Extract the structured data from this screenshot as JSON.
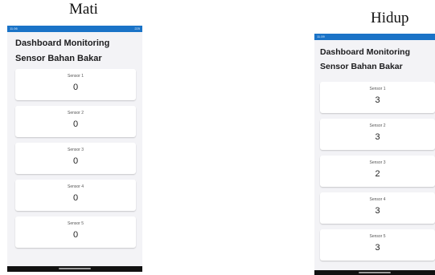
{
  "captions": {
    "left": "Mati",
    "right": "Hidup"
  },
  "screens": [
    {
      "state": "Mati",
      "status_bar": {
        "left": "11.06",
        "right": "225"
      },
      "title_line1": "Dashboard Monitoring",
      "title_line2": "Sensor Bahan Bakar",
      "sensors": [
        {
          "label": "Sensor 1",
          "value": "0"
        },
        {
          "label": "Sensor 2",
          "value": "0"
        },
        {
          "label": "Sensor 3",
          "value": "0"
        },
        {
          "label": "Sensor 4",
          "value": "0"
        },
        {
          "label": "Sensor 5",
          "value": "0"
        }
      ]
    },
    {
      "state": "Hidup",
      "status_bar": {
        "left": "11.09",
        "right": ""
      },
      "title_line1": "Dashboard Monitoring",
      "title_line2": "Sensor Bahan Bakar",
      "sensors": [
        {
          "label": "Sensor 1",
          "value": "3"
        },
        {
          "label": "Sensor 2",
          "value": "3"
        },
        {
          "label": "Sensor 3",
          "value": "2"
        },
        {
          "label": "Sensor 4",
          "value": "3"
        },
        {
          "label": "Sensor 5",
          "value": "3"
        }
      ]
    }
  ],
  "colors": {
    "status_bar": "#1a73c7",
    "background": "#f3f3f6",
    "card": "#ffffff",
    "nav_bar": "#111111"
  }
}
